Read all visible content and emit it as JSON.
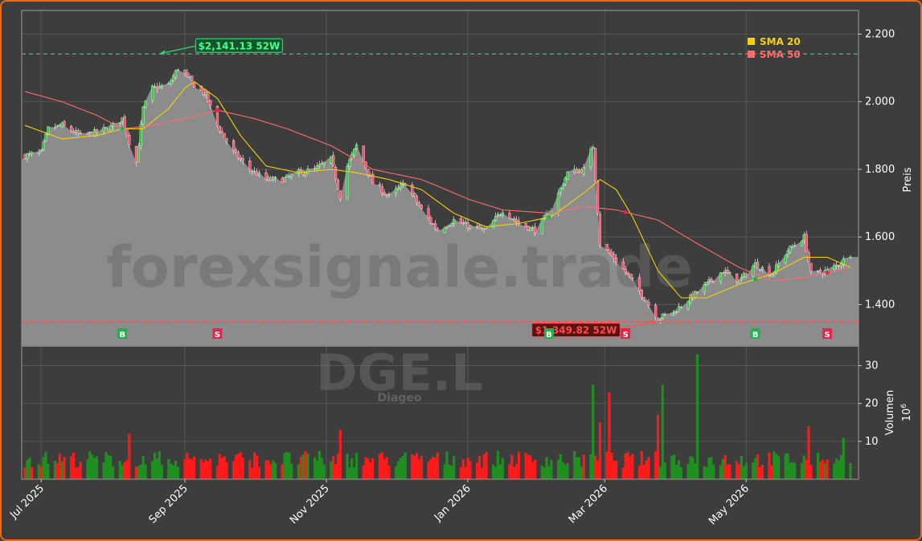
{
  "chart_data": {
    "type": "candlestick",
    "ticker": "DGE.L",
    "company": "Diageo",
    "watermark": "forexsignale.trade",
    "ylabel": "Preis",
    "volume_label": "Volumen",
    "volume_exponent": "10",
    "volume_exponent_power": "6",
    "ylim": [
      1280,
      2270
    ],
    "yticks": [
      "2.200",
      "2.000",
      "1.800",
      "1.600",
      "1.400"
    ],
    "ytick_values": [
      2200,
      2000,
      1800,
      1600,
      1400
    ],
    "volume_ylim": [
      0,
      35
    ],
    "volume_ticks": [
      "30",
      "20",
      "10"
    ],
    "volume_tick_values": [
      30,
      20,
      10
    ],
    "xlim": [
      "2025-06-24",
      "2026-06-15"
    ],
    "xticks": [
      "Jul 2025",
      "Sep 2025",
      "Nov 2025",
      "Jan 2026",
      "Mar 2026",
      "May 2026"
    ],
    "xtick_dates": [
      "2025-07-01",
      "2025-09-01",
      "2025-11-01",
      "2026-01-01",
      "2026-03-01",
      "2026-05-01"
    ],
    "legend": [
      {
        "label": "SMA 20",
        "color": "#f5d10a"
      },
      {
        "label": "SMA 50",
        "color": "#ff6b6b"
      }
    ],
    "legend_position": "top-right",
    "high_52w": {
      "label": "$2,141.13 52W",
      "value": 2141.13,
      "date": "2025-08-20"
    },
    "low_52w": {
      "label": "$1,349.82 52W",
      "value": 1349.82,
      "date": "2026-03-24"
    },
    "signals": [
      {
        "label": "B",
        "date": "2025-08-05",
        "color": "#22b14c"
      },
      {
        "label": "S",
        "date": "2025-09-15",
        "color": "#e8244a"
      },
      {
        "label": "B",
        "date": "2026-02-05",
        "color": "#22b14c"
      },
      {
        "label": "S",
        "date": "2026-03-10",
        "color": "#e8244a"
      },
      {
        "label": "B",
        "date": "2026-05-05",
        "color": "#22b14c"
      },
      {
        "label": "S",
        "date": "2026-06-05",
        "color": "#e8244a"
      }
    ],
    "close_anchors": [
      [
        "2025-06-24",
        1840
      ],
      [
        "2025-07-01",
        1850
      ],
      [
        "2025-07-04",
        1920
      ],
      [
        "2025-07-10",
        1930
      ],
      [
        "2025-07-18",
        1900
      ],
      [
        "2025-07-25",
        1910
      ],
      [
        "2025-07-31",
        1925
      ],
      [
        "2025-08-05",
        1950
      ],
      [
        "2025-08-08",
        1880
      ],
      [
        "2025-08-11",
        1820
      ],
      [
        "2025-08-14",
        1980
      ],
      [
        "2025-08-18",
        2040
      ],
      [
        "2025-08-25",
        2050
      ],
      [
        "2025-08-29",
        2100
      ],
      [
        "2025-09-01",
        2080
      ],
      [
        "2025-09-05",
        2050
      ],
      [
        "2025-09-10",
        2020
      ],
      [
        "2025-09-15",
        1930
      ],
      [
        "2025-09-22",
        1850
      ],
      [
        "2025-09-29",
        1800
      ],
      [
        "2025-10-06",
        1770
      ],
      [
        "2025-10-13",
        1770
      ],
      [
        "2025-10-20",
        1790
      ],
      [
        "2025-10-27",
        1800
      ],
      [
        "2025-11-03",
        1830
      ],
      [
        "2025-11-07",
        1720
      ],
      [
        "2025-11-10",
        1810
      ],
      [
        "2025-11-14",
        1870
      ],
      [
        "2025-11-21",
        1760
      ],
      [
        "2025-11-28",
        1720
      ],
      [
        "2025-12-05",
        1760
      ],
      [
        "2025-12-12",
        1680
      ],
      [
        "2025-12-19",
        1620
      ],
      [
        "2025-12-26",
        1650
      ],
      [
        "2026-01-02",
        1630
      ],
      [
        "2026-01-09",
        1620
      ],
      [
        "2026-01-16",
        1680
      ],
      [
        "2026-01-23",
        1640
      ],
      [
        "2026-01-30",
        1620
      ],
      [
        "2026-02-06",
        1680
      ],
      [
        "2026-02-13",
        1790
      ],
      [
        "2026-02-20",
        1800
      ],
      [
        "2026-02-24",
        1870
      ],
      [
        "2026-02-27",
        1580
      ],
      [
        "2026-03-06",
        1530
      ],
      [
        "2026-03-13",
        1470
      ],
      [
        "2026-03-20",
        1400
      ],
      [
        "2026-03-24",
        1360
      ],
      [
        "2026-03-31",
        1380
      ],
      [
        "2026-04-07",
        1420
      ],
      [
        "2026-04-14",
        1460
      ],
      [
        "2026-04-21",
        1500
      ],
      [
        "2026-04-28",
        1470
      ],
      [
        "2026-05-05",
        1520
      ],
      [
        "2026-05-12",
        1490
      ],
      [
        "2026-05-19",
        1560
      ],
      [
        "2026-05-26",
        1600
      ],
      [
        "2026-05-29",
        1490
      ],
      [
        "2026-06-05",
        1500
      ],
      [
        "2026-06-10",
        1520
      ],
      [
        "2026-06-15",
        1550
      ]
    ],
    "sma20_anchors": [
      [
        "2025-06-24",
        1930
      ],
      [
        "2025-07-10",
        1890
      ],
      [
        "2025-07-25",
        1900
      ],
      [
        "2025-08-05",
        1920
      ],
      [
        "2025-08-14",
        1920
      ],
      [
        "2025-08-25",
        1980
      ],
      [
        "2025-09-01",
        2040
      ],
      [
        "2025-09-05",
        2060
      ],
      [
        "2025-09-15",
        2010
      ],
      [
        "2025-09-25",
        1900
      ],
      [
        "2025-10-06",
        1810
      ],
      [
        "2025-10-20",
        1790
      ],
      [
        "2025-11-03",
        1800
      ],
      [
        "2025-11-14",
        1790
      ],
      [
        "2025-11-28",
        1770
      ],
      [
        "2025-12-12",
        1740
      ],
      [
        "2025-12-26",
        1670
      ],
      [
        "2026-01-09",
        1630
      ],
      [
        "2026-01-23",
        1640
      ],
      [
        "2026-02-06",
        1660
      ],
      [
        "2026-02-20",
        1730
      ],
      [
        "2026-02-27",
        1770
      ],
      [
        "2026-03-06",
        1740
      ],
      [
        "2026-03-13",
        1660
      ],
      [
        "2026-03-24",
        1500
      ],
      [
        "2026-04-03",
        1420
      ],
      [
        "2026-04-14",
        1420
      ],
      [
        "2026-04-28",
        1460
      ],
      [
        "2026-05-12",
        1490
      ],
      [
        "2026-05-26",
        1540
      ],
      [
        "2026-06-05",
        1540
      ],
      [
        "2026-06-15",
        1510
      ]
    ],
    "sma50_anchors": [
      [
        "2025-06-24",
        2030
      ],
      [
        "2025-07-10",
        2000
      ],
      [
        "2025-07-25",
        1960
      ],
      [
        "2025-08-05",
        1920
      ],
      [
        "2025-08-18",
        1930
      ],
      [
        "2025-09-01",
        1950
      ],
      [
        "2025-09-15",
        1975
      ],
      [
        "2025-10-01",
        1950
      ],
      [
        "2025-10-15",
        1920
      ],
      [
        "2025-11-03",
        1870
      ],
      [
        "2025-11-21",
        1800
      ],
      [
        "2025-12-12",
        1770
      ],
      [
        "2026-01-02",
        1710
      ],
      [
        "2026-01-16",
        1680
      ],
      [
        "2026-02-06",
        1670
      ],
      [
        "2026-02-20",
        1690
      ],
      [
        "2026-03-06",
        1680
      ],
      [
        "2026-03-24",
        1650
      ],
      [
        "2026-04-10",
        1580
      ],
      [
        "2026-04-28",
        1510
      ],
      [
        "2026-05-12",
        1470
      ],
      [
        "2026-05-26",
        1480
      ],
      [
        "2026-06-15",
        1510
      ]
    ],
    "volume_spikes": [
      [
        "2025-08-08",
        12
      ],
      [
        "2025-11-07",
        13
      ],
      [
        "2026-02-24",
        25
      ],
      [
        "2026-02-27",
        15
      ],
      [
        "2026-03-03",
        23
      ],
      [
        "2026-03-24",
        17
      ],
      [
        "2026-03-26",
        25
      ],
      [
        "2026-04-10",
        33
      ],
      [
        "2026-05-28",
        14
      ],
      [
        "2026-06-12",
        11
      ]
    ]
  }
}
